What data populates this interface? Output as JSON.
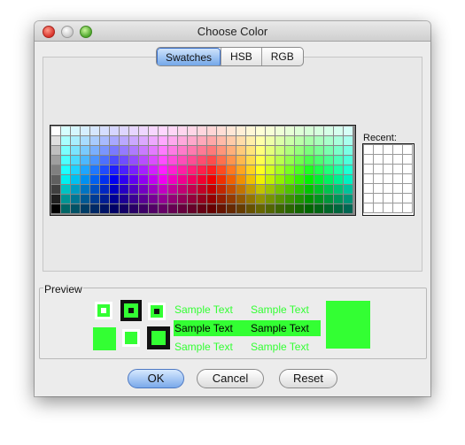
{
  "window": {
    "title": "Choose Color"
  },
  "tabs": [
    {
      "label": "Swatches",
      "active": true
    },
    {
      "label": "HSB",
      "active": false
    },
    {
      "label": "RGB",
      "active": false
    }
  ],
  "recent": {
    "label": "Recent:"
  },
  "preview": {
    "label": "Preview",
    "color": "#33ff33",
    "sample_text": "Sample Text"
  },
  "buttons": {
    "ok": "OK",
    "cancel": "Cancel",
    "reset": "Reset"
  }
}
